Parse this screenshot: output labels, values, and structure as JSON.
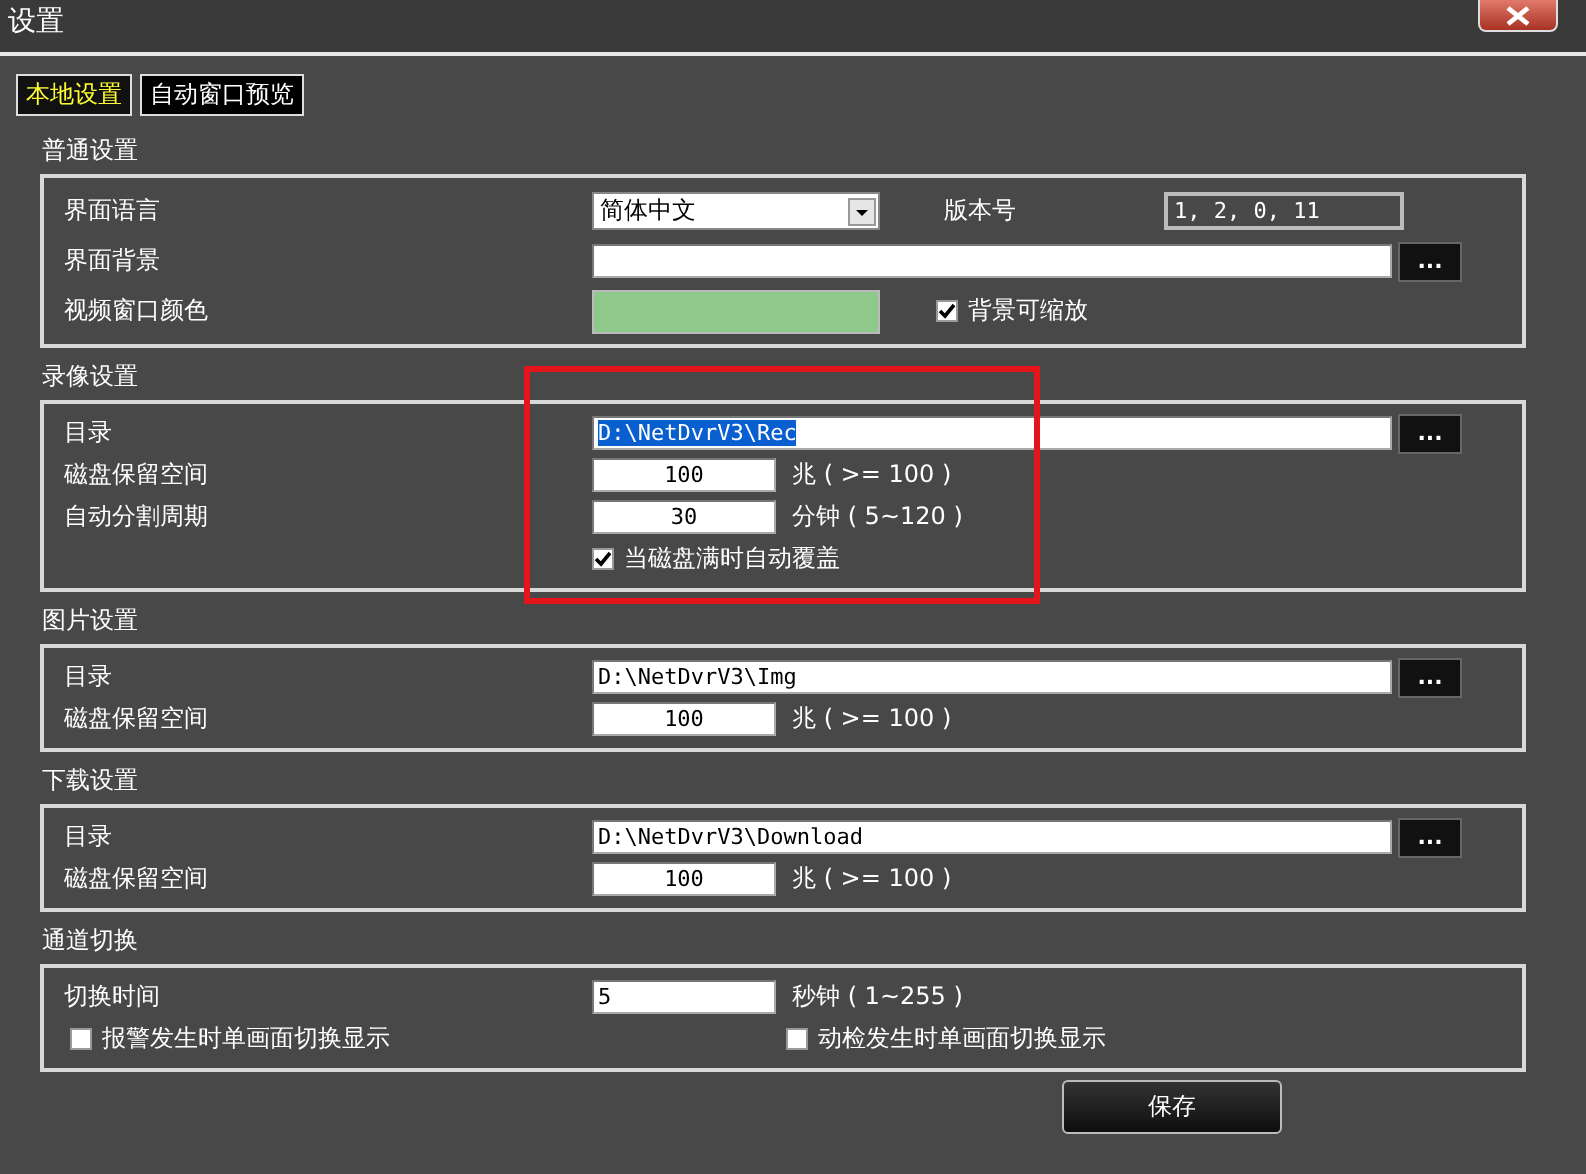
{
  "window": {
    "title": "设置"
  },
  "tabs": [
    {
      "label": "本地设置",
      "selected": true
    },
    {
      "label": "自动窗口预览",
      "selected": false
    }
  ],
  "sections": [
    {
      "title": "普通设置",
      "rows": [
        {
          "kind": "select",
          "label": "界面语言",
          "value": "简体中文",
          "extra_label": "版本号",
          "extra_value": "1, 2, 0, 11"
        },
        {
          "kind": "path",
          "label": "界面背景",
          "browse": "..."
        },
        {
          "kind": "color",
          "label": "视频窗口颜色",
          "color": "#8fc88a",
          "check": {
            "label": "背景可缩放",
            "checked": true
          }
        }
      ]
    },
    {
      "title": "录像设置",
      "highlighted": true,
      "rows": [
        {
          "kind": "path",
          "label": "目录",
          "value": "D:\\NetDvrV3\\Rec",
          "browse": "...",
          "text_selected": true
        },
        {
          "kind": "number",
          "label": "磁盘保留空间",
          "value": "100",
          "unit": "兆 ( >= 100 )"
        },
        {
          "kind": "number",
          "label": "自动分割周期",
          "value": "30",
          "unit": "分钟 ( 5~120 )"
        },
        {
          "kind": "checkbox",
          "label": "当磁盘满时自动覆盖",
          "checked": true
        }
      ]
    },
    {
      "title": "图片设置",
      "rows": [
        {
          "kind": "path",
          "label": "目录",
          "value": "D:\\NetDvrV3\\Img",
          "browse": "..."
        },
        {
          "kind": "number",
          "label": "磁盘保留空间",
          "value": "100",
          "unit": "兆 ( >= 100 )"
        }
      ]
    },
    {
      "title": "下载设置",
      "rows": [
        {
          "kind": "path",
          "label": "目录",
          "value": "D:\\NetDvrV3\\Download",
          "browse": "..."
        },
        {
          "kind": "number",
          "label": "磁盘保留空间",
          "value": "100",
          "unit": "兆 ( >= 100 )"
        }
      ]
    },
    {
      "title": "通道切换",
      "rows": [
        {
          "kind": "text",
          "label": "切换时间",
          "value": "5",
          "unit": "秒钟 ( 1~255 )"
        },
        {
          "kind": "checkbox_pair",
          "items": [
            {
              "label": "报警发生时单画面切换显示",
              "checked": false
            },
            {
              "label": "动检发生时单画面切换显示",
              "checked": false
            }
          ]
        }
      ]
    }
  ],
  "save_button": "保存"
}
